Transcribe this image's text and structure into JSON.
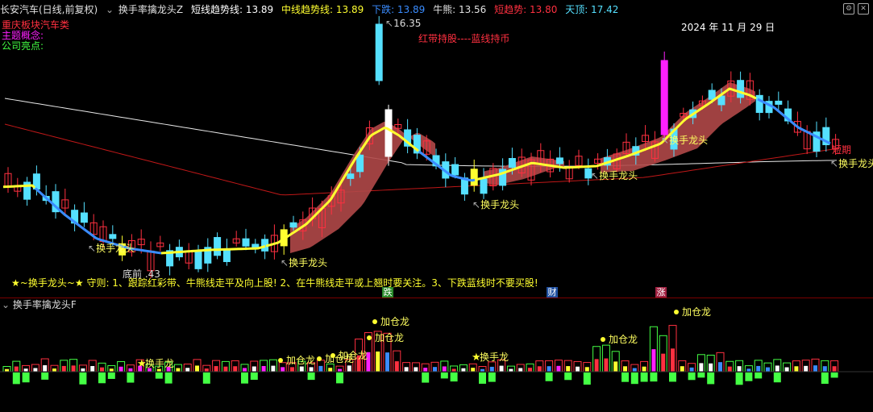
{
  "colors": {
    "up": "#ff3040",
    "down": "#55e0ff",
    "yellow": "#ffff30",
    "blue": "#3a8cff",
    "white": "#ffffff",
    "magenta": "#ff20ff",
    "red_line": "#c01818",
    "green": "#44ff44",
    "ribbon": "#b04848"
  },
  "header": {
    "stock": "长安汽车(日线,前复权)",
    "indicator": "换手率擒龙头Z",
    "short_trend": "短线趋势线: 13.89",
    "mid_trend": "中线趋势线: 13.89",
    "down": "下跌: 13.89",
    "bull": "牛熊: 13.56",
    "short_trend2": "短趋势: 13.80",
    "top": "天顶: 17.42"
  },
  "info": {
    "line1": "重庆板块汽车类",
    "line2": "主题概念:",
    "line3": "公司亮点:"
  },
  "annotations": {
    "high_price": "16.35",
    "low_price": "底前 .43",
    "date": "2024 年 11 月 29 日",
    "red_band": "红带持股----蓝线持币",
    "short_period": "短期",
    "dragon": "换手龙头",
    "dragon_tail": "换手龙头",
    "rules": "★~换手龙头~★ 守则: 1、跟踪红彩带、牛熊线走平及向上股! 2、在牛熊线走平或上翘时要关注。3、下跌蓝线时不要买股!",
    "badge_fall": "跌",
    "badge_fin": "财",
    "badge_rise": "涨"
  },
  "sub_panel": {
    "title": "换手率擒龙头F",
    "labels": {
      "star": "换手龙",
      "add": "加仓龙"
    }
  },
  "icons": [
    "gear-icon",
    "settings-icon",
    "close-icon"
  ]
}
